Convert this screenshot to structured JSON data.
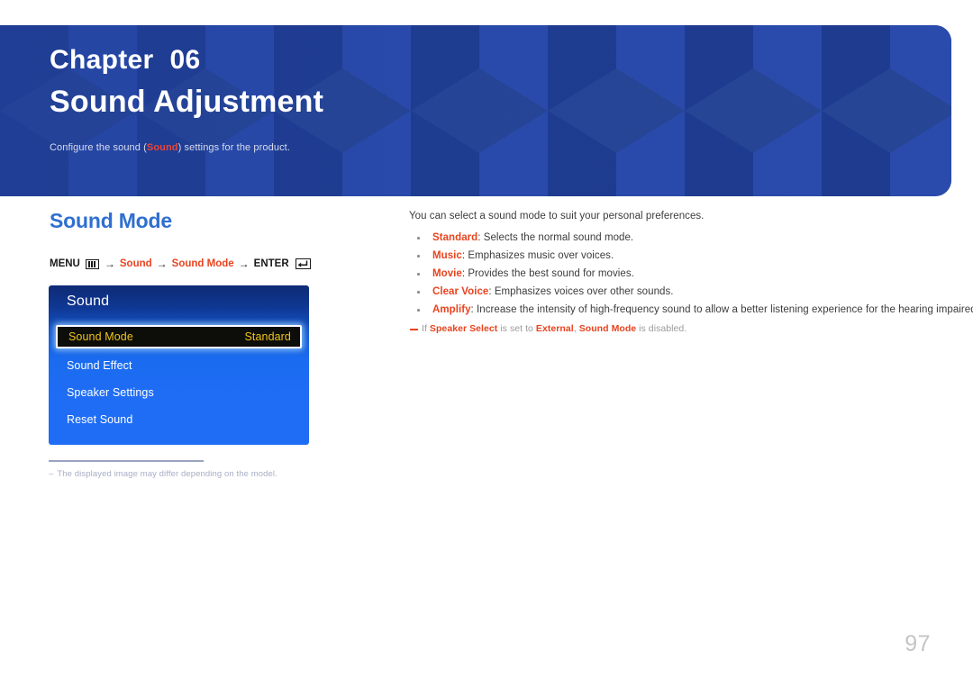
{
  "banner": {
    "chapter_label": "Chapter",
    "chapter_number": "06",
    "title": "Sound Adjustment",
    "description_pre": "Configure the sound (",
    "description_highlight": "Sound",
    "description_post": ") settings for the product.",
    "background_color": "#21409a",
    "highlight_color": "#e8443a"
  },
  "section": {
    "title": "Sound Mode",
    "title_color": "#2f6fd0"
  },
  "menu_path": {
    "menu_label": "MENU",
    "menu_icon": "menu-bars-icon",
    "arrow": "→",
    "step_1": "Sound",
    "step_2": "Sound Mode",
    "enter_label": "ENTER",
    "enter_icon": "enter-return-icon",
    "accent_color": "#e8431f"
  },
  "osd": {
    "title": "Sound",
    "rows": [
      {
        "label": "Sound Mode",
        "value": "Standard",
        "selected": true
      },
      {
        "label": "Sound Effect",
        "value": "",
        "selected": false
      },
      {
        "label": "Speaker Settings",
        "value": "",
        "selected": false
      },
      {
        "label": "Reset Sound",
        "value": "",
        "selected": false
      }
    ],
    "selected_text_color": "#f0c419",
    "selected_bg_color": "#0d0d0a"
  },
  "osd_footnote": {
    "dash": "–",
    "text": "The displayed image may differ depending on the model."
  },
  "content": {
    "lead": "You can select a sound mode to suit your personal preferences.",
    "bullets": [
      {
        "term": "Standard",
        "text": ": Selects the normal sound mode."
      },
      {
        "term": "Music",
        "text": ": Emphasizes music over voices."
      },
      {
        "term": "Movie",
        "text": ": Provides the best sound for movies."
      },
      {
        "term": "Clear Voice",
        "text": ": Emphasizes voices over other sounds."
      },
      {
        "term": "Amplify",
        "text": ": Increase the intensity of high-frequency sound to allow a better listening experience for the hearing impaired."
      }
    ],
    "note": {
      "pre": "If ",
      "term_1": "Speaker Select",
      "mid_1": " is set to ",
      "term_2": "External",
      "mid_2": ", ",
      "term_3": "Sound Mode",
      "post": " is disabled."
    }
  },
  "page_number": "97"
}
